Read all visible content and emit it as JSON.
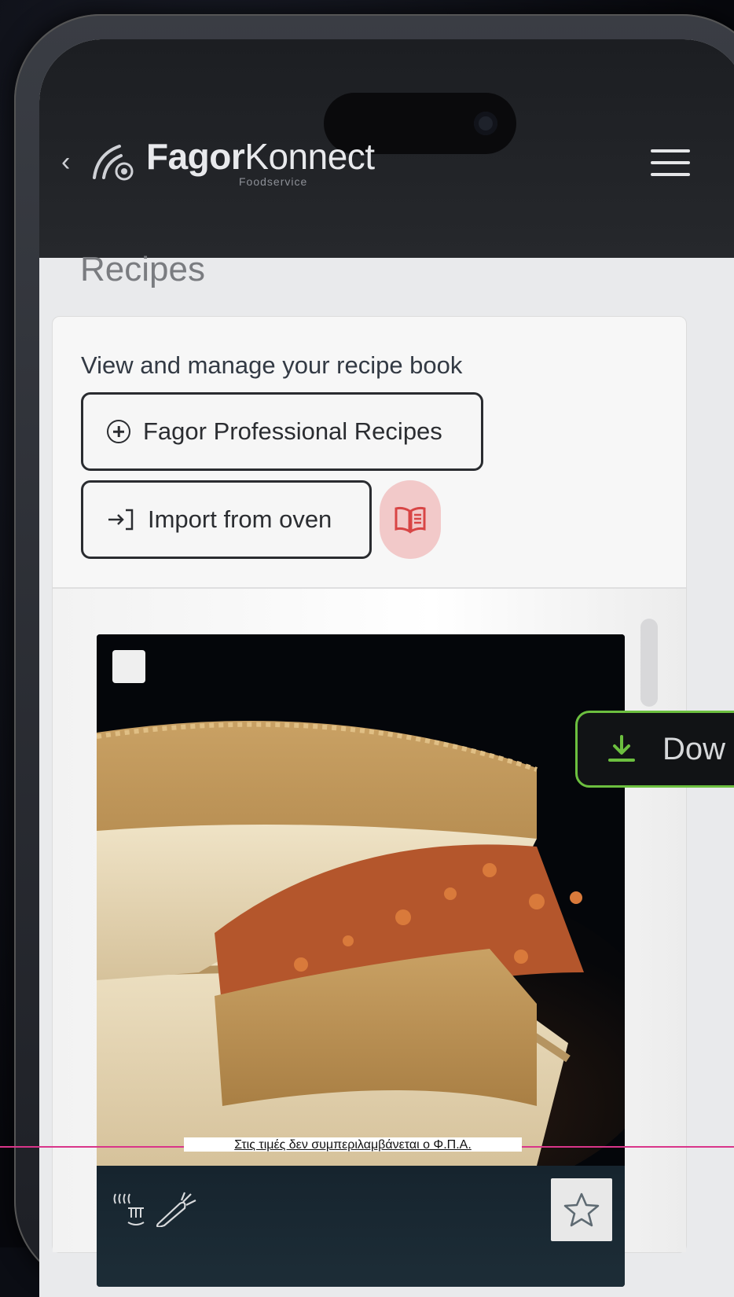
{
  "header": {
    "back_icon": "chevron-left-icon",
    "brand_bold": "Fagor",
    "brand_regular": "Konnect",
    "brand_sub": "Foodservice",
    "menu_icon": "hamburger-icon"
  },
  "page": {
    "title": "Recipes",
    "lead": "View and manage your recipe book"
  },
  "actions": {
    "professional_label": "Fagor Professional Recipes",
    "import_label": "Import from oven",
    "recipe_book_icon": "recipe-book-icon"
  },
  "recipe_card": {
    "image": "puff-pastry-pie-photo",
    "favorite_icon": "star-outline-icon",
    "category_icons": [
      "steam-icon",
      "vegetable-icon"
    ]
  },
  "download_button": {
    "label": "Dow",
    "icon": "download-icon",
    "accent": "#6cbf3f"
  },
  "notice": "Στις τιμές δεν συμπεριλαμβάνεται ο Φ.Π.Α.",
  "colors": {
    "header_bg": "#1c1e22",
    "book_badge": "#f2c9c9",
    "book_icon": "#d84545",
    "overlay_line": "#d9358a"
  }
}
